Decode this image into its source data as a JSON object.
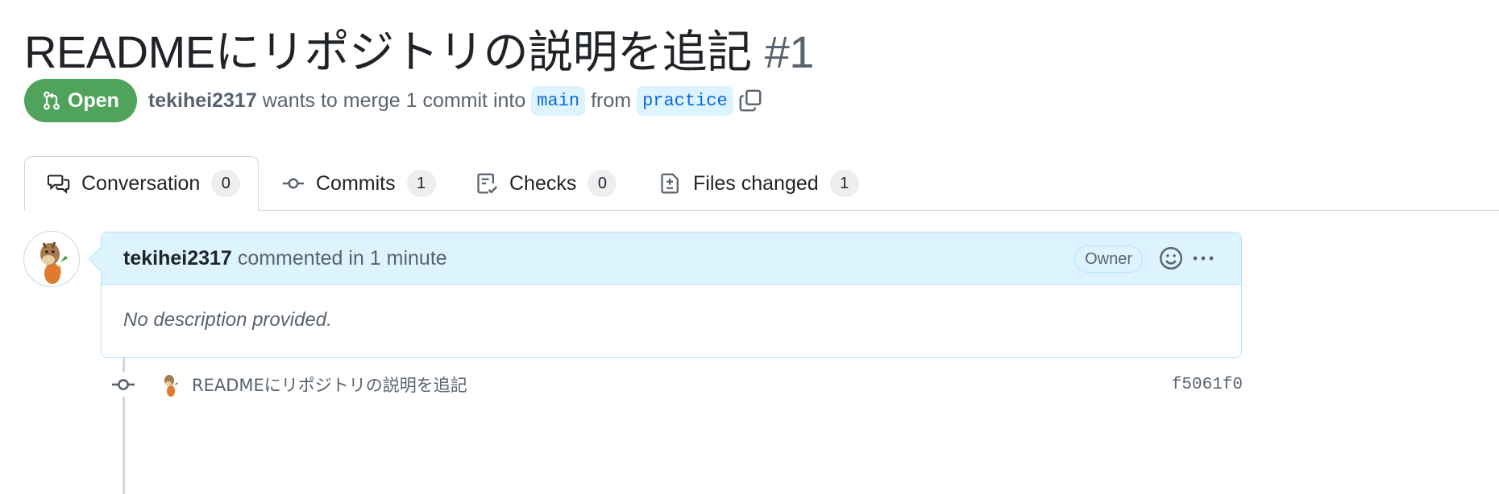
{
  "pr": {
    "title": "READMEにリポジトリの説明を追記",
    "number": "#1",
    "state": "Open",
    "author": "tekihei2317",
    "meta_text": "wants to merge 1 commit into",
    "base_branch": "main",
    "from_text": "from",
    "head_branch": "practice"
  },
  "tabs": [
    {
      "label": "Conversation",
      "count": "0",
      "icon": "comment-discussion-icon"
    },
    {
      "label": "Commits",
      "count": "1",
      "icon": "git-commit-icon"
    },
    {
      "label": "Checks",
      "count": "0",
      "icon": "checklist-icon"
    },
    {
      "label": "Files changed",
      "count": "1",
      "icon": "file-diff-icon"
    }
  ],
  "comment": {
    "author": "tekihei2317",
    "action_text": "commented in 1 minute",
    "role_badge": "Owner",
    "body": "No description provided."
  },
  "commit": {
    "message": "READMEにリポジトリの説明を追記",
    "sha": "f5061f0"
  },
  "colors": {
    "open_green": "#4fa35a",
    "accent_blue": "#0969da",
    "comment_header_bg": "#ddf4ff",
    "comment_border": "#b6e3ff"
  }
}
